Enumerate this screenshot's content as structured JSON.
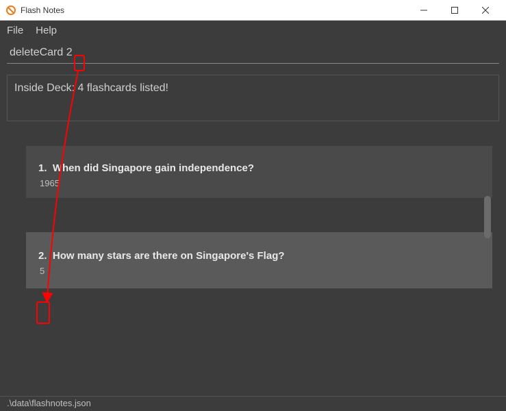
{
  "window": {
    "title": "Flash Notes"
  },
  "menu": {
    "file": "File",
    "help": "Help"
  },
  "command": {
    "value": "deleteCard 2"
  },
  "status": {
    "message": "Inside Deck: 4 flashcards listed!"
  },
  "cards": [
    {
      "number": "1.",
      "question": "When did Singapore gain independence?",
      "answer": "1965"
    },
    {
      "number": "2.",
      "question": "How many stars are there on Singapore's Flag?",
      "answer": "5"
    }
  ],
  "footer": {
    "path": ".\\data\\flashnotes.json"
  }
}
